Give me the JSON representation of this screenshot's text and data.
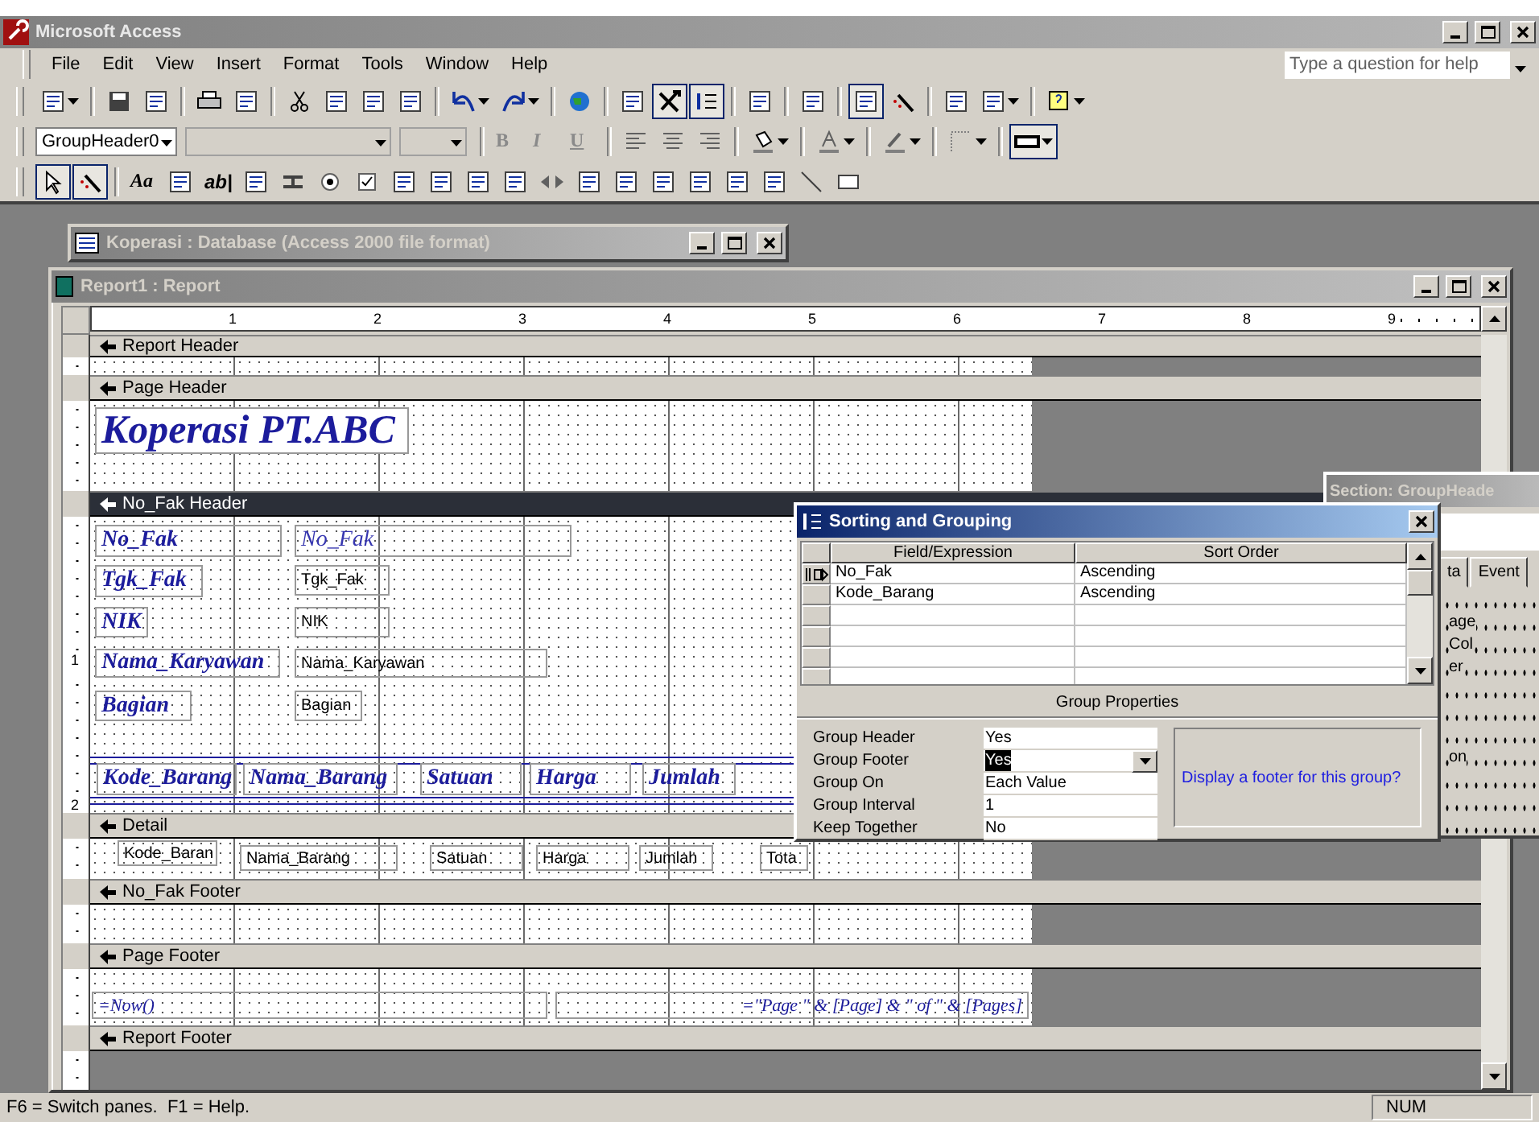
{
  "window": {
    "title": "Microsoft Access",
    "help_placeholder": "Type a question for help"
  },
  "menu": [
    "File",
    "Edit",
    "View",
    "Insert",
    "Format",
    "Tools",
    "Window",
    "Help"
  ],
  "toolbars": [
    {
      "items": [
        {
          "kind": "icon",
          "pressed": false
        },
        {
          "kind": "icon",
          "pressed": false
        },
        {
          "kind": "icon",
          "pressed": false
        },
        {
          "kind": "icon",
          "pressed": false
        },
        {
          "kind": "icon",
          "pressed": false
        },
        {
          "kind": "icon",
          "pressed": false
        },
        {
          "kind": "icon",
          "pressed": false
        },
        {
          "kind": "icon",
          "pressed": false
        },
        {
          "kind": "icon",
          "pressed": false
        },
        {
          "kind": "icon",
          "pressed": false
        },
        {
          "kind": "icon",
          "pressed": false
        },
        {
          "kind": "icon",
          "pressed": false
        },
        {
          "kind": "icon",
          "pressed": false
        },
        {
          "kind": "icon",
          "pressed": true
        },
        {
          "kind": "icon",
          "pressed": true
        },
        {
          "kind": "icon",
          "pressed": false
        },
        {
          "kind": "icon",
          "pressed": false
        },
        {
          "kind": "icon",
          "pressed": true
        },
        {
          "kind": "icon",
          "pressed": false
        },
        {
          "kind": "icon",
          "pressed": false
        },
        {
          "kind": "icon",
          "pressed": false
        },
        {
          "kind": "icon",
          "pressed": false
        }
      ]
    },
    {
      "items": [
        {
          "kind": "combo",
          "value": "GroupHeader0",
          "disabled": false
        },
        {
          "kind": "combo",
          "disabled": true
        },
        {
          "kind": "combo",
          "disabled": true
        },
        {
          "kind": "text",
          "label": "B",
          "disabled": true
        },
        {
          "kind": "text",
          "label": "I",
          "disabled": true
        },
        {
          "kind": "text",
          "label": "U",
          "disabled": true
        },
        {
          "kind": "icon",
          "pressed": false
        },
        {
          "kind": "icon",
          "pressed": false
        },
        {
          "kind": "icon",
          "pressed": false
        },
        {
          "kind": "icon",
          "pressed": false
        },
        {
          "kind": "icon",
          "pressed": false
        },
        {
          "kind": "icon",
          "pressed": false
        },
        {
          "kind": "icon",
          "pressed": false
        },
        {
          "kind": "icon",
          "pressed": true
        }
      ]
    },
    {
      "items": [
        {
          "kind": "icon",
          "pressed": true
        },
        {
          "kind": "icon",
          "pressed": true
        },
        {
          "kind": "text",
          "label": "Aa",
          "disabled": false
        },
        {
          "kind": "icon",
          "pressed": false
        },
        {
          "kind": "text",
          "label": "ab|",
          "disabled": false
        },
        {
          "kind": "icon",
          "pressed": false
        },
        {
          "kind": "icon",
          "pressed": false
        },
        {
          "kind": "icon",
          "pressed": false
        },
        {
          "kind": "icon",
          "pressed": false
        },
        {
          "kind": "icon",
          "pressed": false
        },
        {
          "kind": "icon",
          "pressed": false
        },
        {
          "kind": "icon",
          "pressed": false
        },
        {
          "kind": "icon",
          "pressed": false
        },
        {
          "kind": "icon",
          "pressed": false
        },
        {
          "kind": "icon",
          "pressed": false
        },
        {
          "kind": "icon",
          "pressed": false
        },
        {
          "kind": "icon",
          "pressed": false
        },
        {
          "kind": "icon",
          "pressed": false
        },
        {
          "kind": "icon",
          "pressed": false
        },
        {
          "kind": "icon",
          "pressed": false
        },
        {
          "kind": "icon",
          "pressed": false
        },
        {
          "kind": "icon",
          "pressed": false
        }
      ]
    }
  ],
  "database_window": {
    "title": "Koperasi : Database (Access 2000 file format)"
  },
  "report_window": {
    "title": "Report1 : Report",
    "ruler": [
      "1",
      "2",
      "3",
      "4",
      "5",
      "6",
      "7",
      "8",
      "9"
    ],
    "sections": [
      {
        "title": "Report Header",
        "selected": false
      },
      {
        "title": "Page Header",
        "selected": false,
        "controls": [
          {
            "kind": "title",
            "text": "Koperasi PT.ABC"
          }
        ]
      },
      {
        "title": "No_Fak Header",
        "selected": true,
        "ruler": [
          "1",
          "2"
        ],
        "controls": [
          {
            "kind": "label",
            "text": "No_Fak"
          },
          {
            "kind": "styled-textbox",
            "text": "No_Fak"
          },
          {
            "kind": "label",
            "text": "Tgk_Fak"
          },
          {
            "kind": "textbox",
            "text": "Tgk_Fak"
          },
          {
            "kind": "label",
            "text": "NIK"
          },
          {
            "kind": "textbox",
            "text": "NIK"
          },
          {
            "kind": "label",
            "text": "Nama_Karyawan"
          },
          {
            "kind": "textbox",
            "text": "Nama_Karyawan"
          },
          {
            "kind": "label",
            "text": "Bagian"
          },
          {
            "kind": "textbox",
            "text": "Bagian"
          },
          {
            "kind": "label",
            "text": "Kode_Barang"
          },
          {
            "kind": "label",
            "text": "Nama_Barang"
          },
          {
            "kind": "label",
            "text": "Satuan"
          },
          {
            "kind": "label",
            "text": "Harga"
          },
          {
            "kind": "label",
            "text": "Jumlah"
          }
        ]
      },
      {
        "title": "Detail",
        "selected": false,
        "controls": [
          {
            "kind": "textbox",
            "text": "Kode_Baran"
          },
          {
            "kind": "textbox",
            "text": "Nama_Barang"
          },
          {
            "kind": "textbox",
            "text": "Satuan"
          },
          {
            "kind": "textbox",
            "text": "Harga"
          },
          {
            "kind": "textbox",
            "text": "Jumlah"
          },
          {
            "kind": "textbox",
            "text": "Tota"
          }
        ]
      },
      {
        "title": "No_Fak Footer",
        "selected": false
      },
      {
        "title": "Page Footer",
        "selected": false,
        "controls": [
          {
            "kind": "expression",
            "text": "=Now()"
          },
          {
            "kind": "expression",
            "text": "=\"Page \" & [Page] & \" of \" & [Pages]"
          }
        ]
      },
      {
        "title": "Report Footer",
        "selected": false
      }
    ]
  },
  "property_sheet": {
    "title": "Section: GroupHeade",
    "tabs": [
      "ta",
      "Event"
    ],
    "rows": [
      {},
      {
        "text": "age"
      },
      {
        "text": "Col"
      },
      {
        "text": "er"
      },
      {},
      {},
      {},
      {
        "text": "on"
      },
      {},
      {},
      {}
    ]
  },
  "sorting_dialog": {
    "title": "Sorting and Grouping",
    "columns": [
      "Field/Expression",
      "Sort Order"
    ],
    "rows": [
      {
        "field": "No_Fak",
        "order": "Ascending",
        "current": true
      },
      {
        "field": "Kode_Barang",
        "order": "Ascending",
        "current": false
      }
    ],
    "group_properties_title": "Group Properties",
    "properties": [
      {
        "label": "Group Header",
        "value": "Yes",
        "focused": false
      },
      {
        "label": "Group Footer",
        "value": "Yes",
        "focused": true
      },
      {
        "label": "Group On",
        "value": "Each Value",
        "focused": false
      },
      {
        "label": "Group Interval",
        "value": "1",
        "focused": false
      },
      {
        "label": "Keep Together",
        "value": "No",
        "focused": false
      }
    ],
    "help": "Display a footer for this group?"
  },
  "status_bar": {
    "message": "F6 = Switch panes.  F1 = Help.",
    "indicator": "NUM"
  }
}
